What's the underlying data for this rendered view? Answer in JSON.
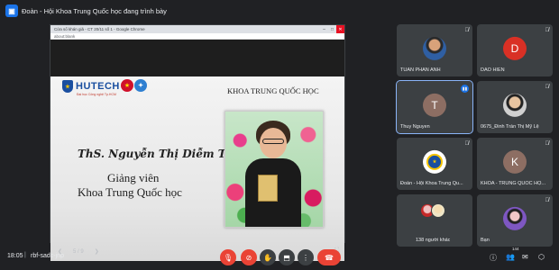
{
  "presenter_banner": {
    "text": "Đoàn - Hội Khoa Trung Quốc học đang trình bày"
  },
  "shared_window": {
    "chrome_title": "Cửa sổ khán giả - CT 20/11 số 1 - Google Chrome",
    "address": "about:blank"
  },
  "slide": {
    "logo_text": "HUTECH",
    "logo_sub": "Đại học Công nghệ Tp.HCM",
    "khoa_title": "KHOA TRUNG QUỐC HỌC",
    "name": "ThS. Nguyễn Thị Diễm Thúy",
    "role": "Giảng viên",
    "department": "Khoa Trung Quốc học",
    "page_indicator": "5 / 9"
  },
  "participants": [
    {
      "name": "TUAN PHAN ANH",
      "avatar": "photo",
      "mic": "muted"
    },
    {
      "name": "DAO HIEN",
      "avatar": "letter",
      "letter": "D",
      "mic": "muted"
    },
    {
      "name": "Thuy Nguyen",
      "avatar": "letter",
      "letter": "T",
      "mic": "speaking",
      "active": true
    },
    {
      "name": "0675_Đinh Trần Thị Mỹ Lệ",
      "avatar": "photo",
      "mic": "muted"
    },
    {
      "name": "Đoàn - Hội Khoa Trung Qu...",
      "avatar": "logo",
      "mic": "muted"
    },
    {
      "name": "KHOA - TRUNG QUỐC HỌ...",
      "avatar": "letter",
      "letter": "K",
      "mic": "muted"
    },
    {
      "name": "",
      "others_label": "138 người khác",
      "avatar": "group"
    },
    {
      "name": "Bạn",
      "avatar": "photo",
      "mic": "muted"
    }
  ],
  "bottom_bar": {
    "time": "18:05",
    "separator": "|",
    "meeting_code": "rbf-sadc-jnp",
    "participant_count_badge": "144"
  },
  "colors": {
    "background": "#202124",
    "tile": "#3c4043",
    "danger": "#ea4335",
    "accent": "#8ab4f8"
  }
}
